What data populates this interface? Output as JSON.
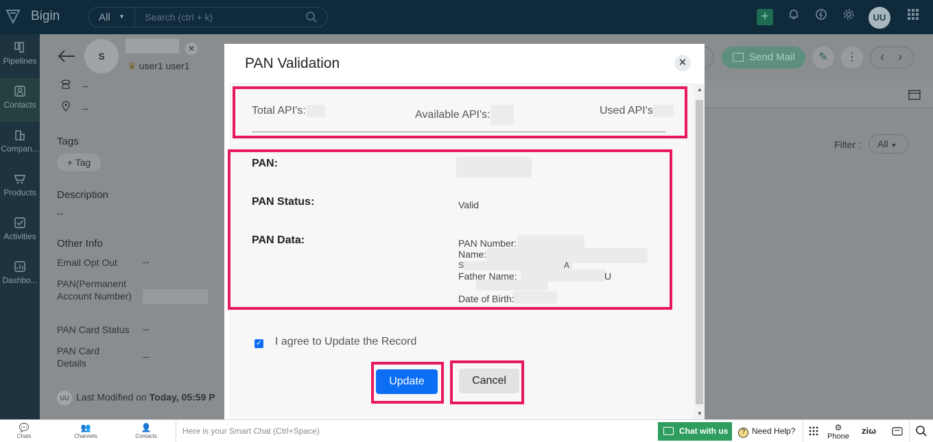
{
  "app": {
    "brand": "Bigin",
    "search_scope": "All",
    "search_placeholder": "Search (ctrl + k)",
    "user_initials": "UU"
  },
  "nav": {
    "items": [
      {
        "label": "Pipelines",
        "icon": "pipelines-icon"
      },
      {
        "label": "Contacts",
        "icon": "contacts-icon"
      },
      {
        "label": "Compan...",
        "icon": "companies-icon"
      },
      {
        "label": "Products",
        "icon": "products-icon"
      },
      {
        "label": "Activities",
        "icon": "activities-icon"
      },
      {
        "label": "Dashbo...",
        "icon": "dashboards-icon"
      }
    ]
  },
  "record": {
    "avatar_initial": "S",
    "owner": "user1 user1",
    "phone_value": "--",
    "location_value": "--",
    "tags_heading": "Tags",
    "tag_button": "+ Tag",
    "description_heading": "Description",
    "description_value": "--",
    "other_info_heading": "Other Info",
    "fields": [
      {
        "label": "Email Opt Out",
        "value": "--"
      },
      {
        "label": "PAN(Permanent Account Number)",
        "value": ""
      },
      {
        "label": "PAN Card Status",
        "value": "--"
      },
      {
        "label": "PAN Card Details",
        "value": "--"
      }
    ],
    "modified_prefix": "Last Modified on",
    "modified_value": "Today, 05:59 P",
    "send_mail": "Send Mail",
    "filter_label": "Filter :",
    "filter_value": "All"
  },
  "modal": {
    "title": "PAN Validation",
    "total_api_label": "Total API's:",
    "available_api_label": "Available API's:",
    "used_api_label": "Used API's",
    "pan_label": "PAN:",
    "pan_status_label": "PAN Status:",
    "pan_status_value": "Valid",
    "pan_data_label": "PAN Data:",
    "pan_data_lines": {
      "pan_number": "PAN Number:",
      "name": "Name:",
      "s_line": "S",
      "a_char": "A",
      "father_name": "Father Name:",
      "u_char": "U",
      "dob": "Date of Birth:"
    },
    "agree_text": "I agree to Update the Record",
    "agree_checked": true,
    "update_button": "Update",
    "cancel_button": "Cancel",
    "highlight_color": "#e8195a",
    "primary_color": "#0b6ef5"
  },
  "bottom": {
    "chats": "Chats",
    "channels": "Channels",
    "contacts": "Contacts",
    "smart_chat_placeholder": "Here is your Smart Chat (Ctrl+Space)",
    "chat_with_us": "Chat with us",
    "need_help": "Need Help?",
    "phone": "Phone",
    "zia": "ziω"
  }
}
